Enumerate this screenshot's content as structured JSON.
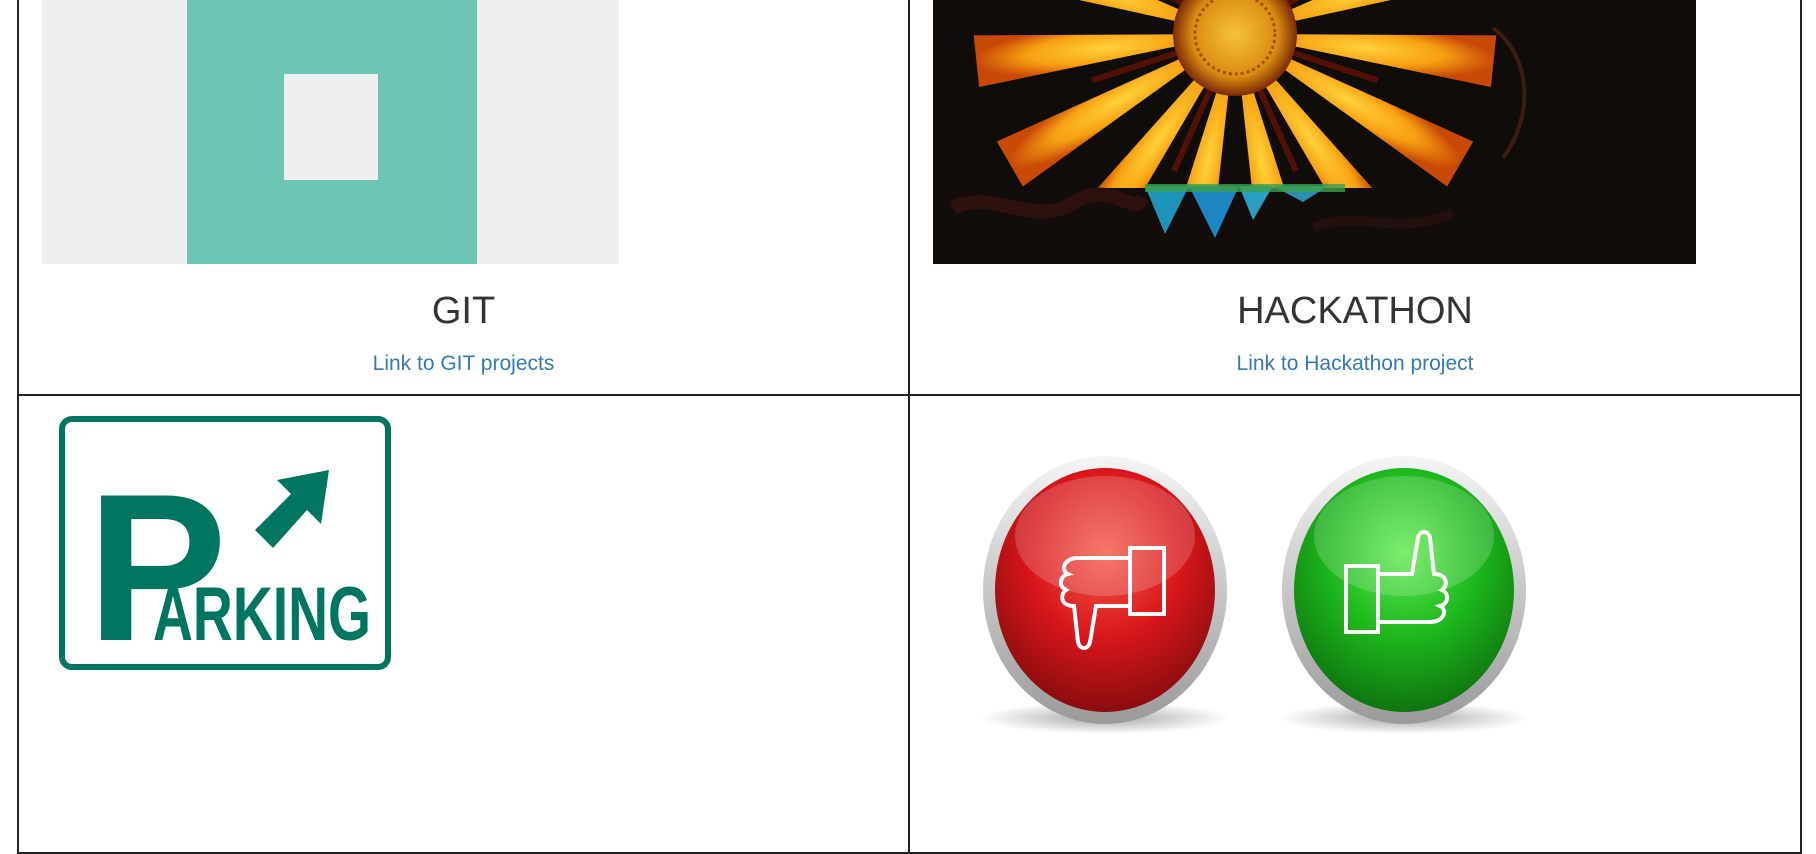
{
  "cards": [
    {
      "title": "GIT",
      "link": "Link to GIT projects",
      "image_icon": "placeholder-image"
    },
    {
      "title": "HACKATHON",
      "link": "Link to Hackathon project",
      "image_icon": "sunflower-photo"
    },
    {
      "sign_text_p": "P",
      "sign_text_rest": "ARKING",
      "image_icon": "parking-sign"
    },
    {
      "image_icon": "thumbs-up-down"
    }
  ],
  "colors": {
    "link": "#337ab7",
    "title": "#333333",
    "border": "#222222",
    "placeholder_bg": "#efefef",
    "placeholder_accent": "#6cc6b3",
    "parking_green": "#007560",
    "dislike_red": "#c4161c",
    "like_green": "#1db01d"
  }
}
